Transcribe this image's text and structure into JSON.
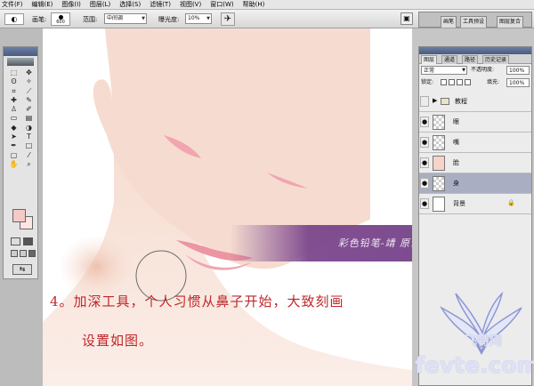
{
  "menubar": [
    "文件(F)",
    "编辑(E)",
    "图像(I)",
    "图层(L)",
    "选择(S)",
    "滤镜(T)",
    "视图(V)",
    "窗口(W)",
    "帮助(H)"
  ],
  "options": {
    "brush_label": "画笔:",
    "brush_size": "600",
    "range_label": "范围:",
    "range_value": "中间调",
    "exposure_label": "曝光度:",
    "exposure_value": "10%"
  },
  "panel_well_tabs": [
    "画笔",
    "工具预设",
    "图层复合"
  ],
  "canvas": {
    "banner_text": "彩色铅笔-靖  原创教程",
    "instruction_line1": "4。加深工具，个人习惯从鼻子开始，大致刻画",
    "instruction_line2": "设置如图。"
  },
  "layers_panel": {
    "tabs": [
      "图层",
      "通道",
      "路径",
      "历史记录"
    ],
    "blend_mode": "正常",
    "opacity_label": "不透明度:",
    "opacity_value": "100%",
    "lock_label": "锁定:",
    "fill_label": "填充:",
    "fill_value": "100%",
    "layers": [
      {
        "name": "教程",
        "type": "group",
        "visible": false
      },
      {
        "name": "眼",
        "type": "layer",
        "visible": true
      },
      {
        "name": "嘴",
        "type": "layer",
        "visible": true
      },
      {
        "name": "脸",
        "type": "layer",
        "visible": true
      },
      {
        "name": "身",
        "type": "layer",
        "visible": true,
        "selected": true
      },
      {
        "name": "背景",
        "type": "background",
        "visible": true,
        "locked": true
      }
    ]
  },
  "watermark": {
    "cn": "飞特网",
    "en": "fevte.com"
  },
  "colors": {
    "foreground": "#f4c9c7",
    "background": "#fbe6e3",
    "instruction_text": "#c0262a",
    "banner": "#7b4a8e"
  }
}
